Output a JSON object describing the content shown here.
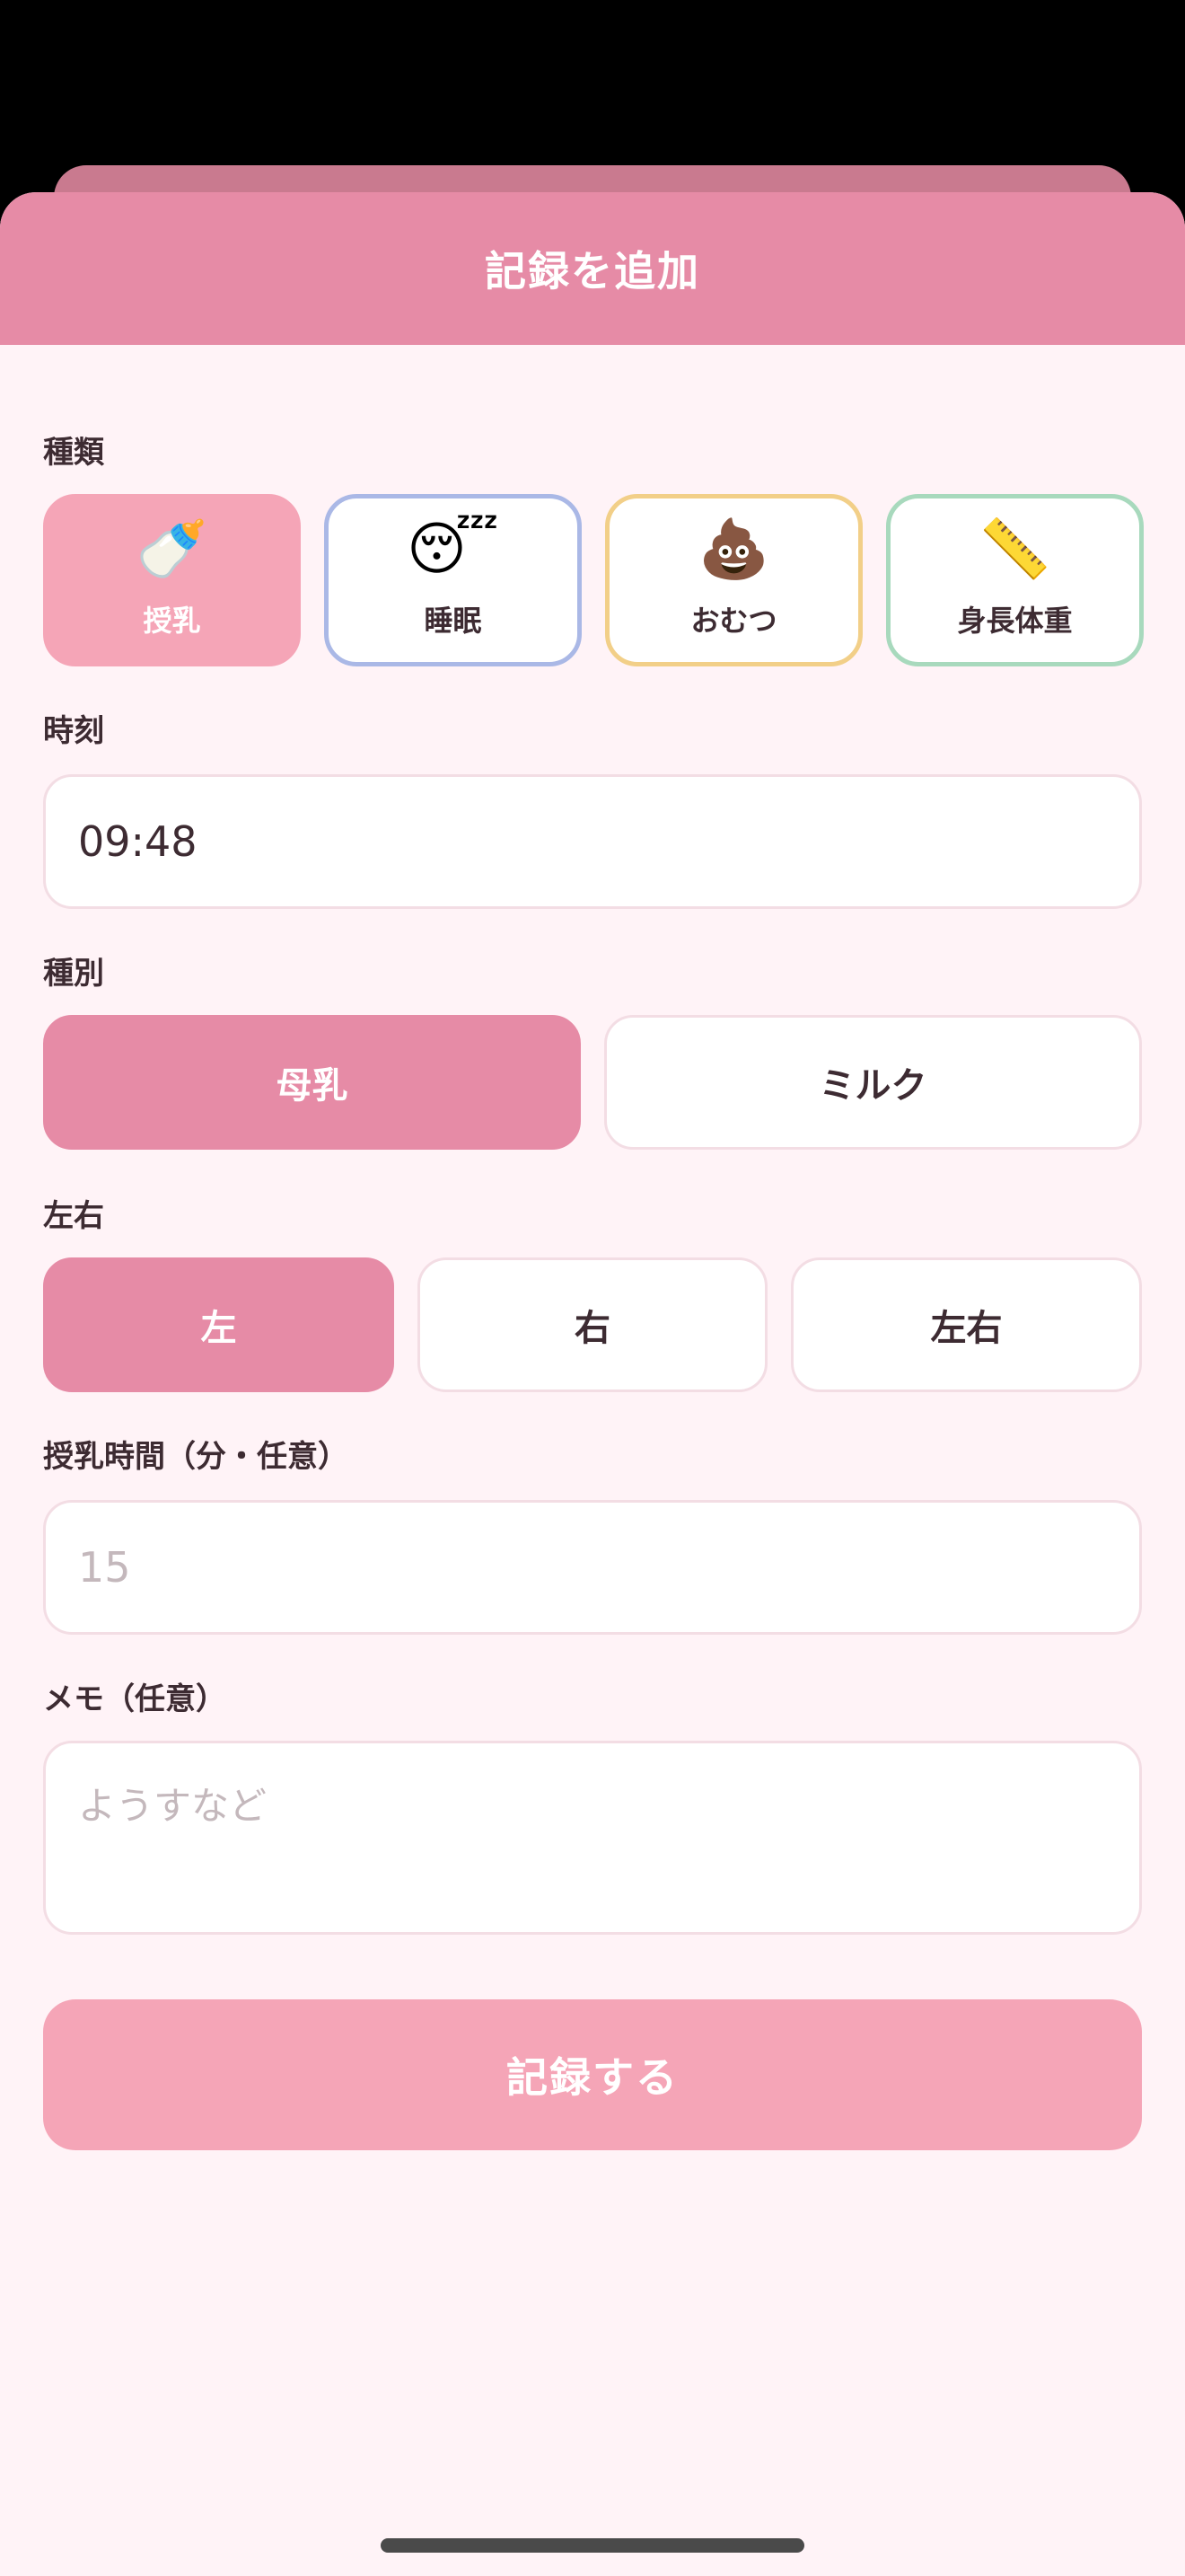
{
  "header": {
    "title": "記録を追加"
  },
  "category": {
    "label": "種類",
    "items": [
      {
        "icon": "🍼",
        "label": "授乳"
      },
      {
        "icon": "😴",
        "label": "睡眠"
      },
      {
        "icon": "💩",
        "label": "おむつ"
      },
      {
        "icon": "📏",
        "label": "身長体重"
      }
    ],
    "selected": "授乳"
  },
  "time": {
    "label": "時刻",
    "value": "09:48"
  },
  "feed_type": {
    "label": "種別",
    "options": [
      "母乳",
      "ミルク"
    ],
    "selected": "母乳"
  },
  "side": {
    "label": "左右",
    "options": [
      "左",
      "右",
      "左右"
    ],
    "selected": "左"
  },
  "duration": {
    "label": "授乳時間（分・任意）",
    "placeholder": "15"
  },
  "memo": {
    "label": "メモ（任意）",
    "placeholder": "ようすなど"
  },
  "submit": {
    "label": "記録する"
  },
  "colors": {
    "header": "#e68ba6",
    "accent_light": "#f5a5b7",
    "sheet_bg": "#fff3f7",
    "sleep_border": "#aab8e6",
    "diaper_border": "#f2cf88",
    "growth_border": "#a8d9bd"
  }
}
